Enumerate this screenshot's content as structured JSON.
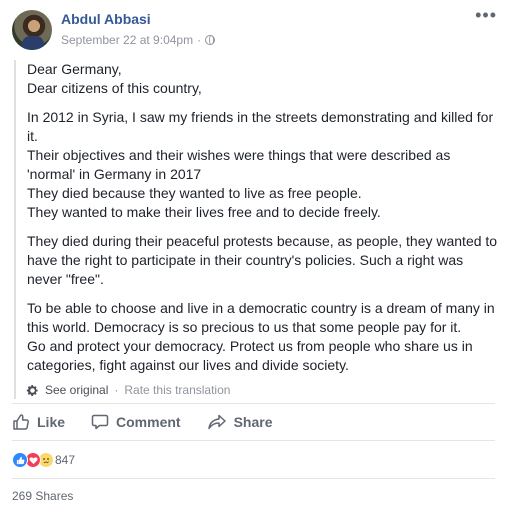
{
  "post": {
    "author": "Abdul Abbasi",
    "timestamp": "September 22 at 9:04pm",
    "separator": "·",
    "more_label": "•••",
    "paragraphs": [
      [
        "Dear Germany,",
        "Dear citizens of this country,"
      ],
      [
        "In 2012 in Syria, I saw my friends in the streets demonstrating and killed for",
        "it.",
        "Their objectives and their wishes were things that were described as",
        "'normal' in Germany in 2017",
        "They died because they wanted to live as free people.",
        "They wanted to make their lives free and to decide freely."
      ],
      [
        "They died during their peaceful protests because, as people, they wanted to",
        "have the right to participate in their country's policies. Such a right was",
        "never \"free\"."
      ],
      [
        "To be able to choose and live in a democratic country is a dream of many in",
        "this world. Democracy is so precious to us that some people pay for it.",
        "Go and protect your democracy. Protect us from people who share us in",
        "categories, fight against our lives and divide society."
      ]
    ],
    "see_original": "See original",
    "translation_sep": "·",
    "rate_translation": "Rate this translation"
  },
  "actions": {
    "like": "Like",
    "comment": "Comment",
    "share": "Share"
  },
  "stats": {
    "reaction_count": "847",
    "reaction_icons": [
      "like-reaction-icon",
      "love-reaction-icon",
      "sad-reaction-icon"
    ],
    "shares": "269 Shares"
  },
  "colors": {
    "author_link": "#365899",
    "meta_gray": "#90949c",
    "action_gray": "#606770",
    "like_blue": "#2e89ff",
    "love_red": "#f33e58",
    "sad_yellow": "#fcd869"
  }
}
